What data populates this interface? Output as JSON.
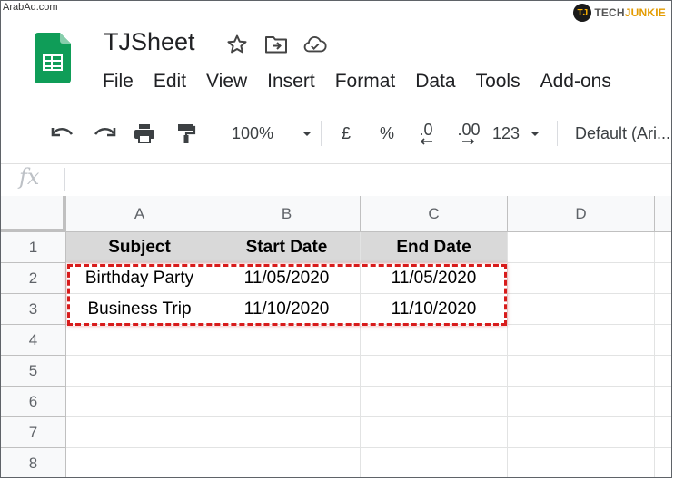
{
  "watermark": {
    "left": "ArabAq.com",
    "right_logo": "TJ",
    "right_text_1": "TECH",
    "right_text_2": "JUNKIE"
  },
  "doc": {
    "title": "TJSheet"
  },
  "menu": [
    "File",
    "Edit",
    "View",
    "Insert",
    "Format",
    "Data",
    "Tools",
    "Add-ons"
  ],
  "toolbar": {
    "zoom": "100%",
    "currency": "£",
    "percent": "%",
    "dec_decrease": ".0",
    "dec_increase": ".00",
    "more_formats": "123",
    "font": "Default (Ari..."
  },
  "formula_bar": {
    "fx_label": "fx",
    "value": ""
  },
  "columns": [
    "A",
    "B",
    "C",
    "D"
  ],
  "rows": [
    "1",
    "2",
    "3",
    "4",
    "5",
    "6",
    "7",
    "8"
  ],
  "cells": [
    [
      "Subject",
      "Start Date",
      "End Date",
      ""
    ],
    [
      "Birthday Party",
      "11/05/2020",
      "11/05/2020",
      ""
    ],
    [
      "Business Trip",
      "11/10/2020",
      "11/10/2020",
      ""
    ],
    [
      "",
      "",
      "",
      ""
    ],
    [
      "",
      "",
      "",
      ""
    ],
    [
      "",
      "",
      "",
      ""
    ],
    [
      "",
      "",
      "",
      ""
    ],
    [
      "",
      "",
      "",
      ""
    ]
  ],
  "colors": {
    "highlight": "#d81b1b",
    "header_fill": "#d9d9d9",
    "sheets_green": "#0f9d58"
  }
}
